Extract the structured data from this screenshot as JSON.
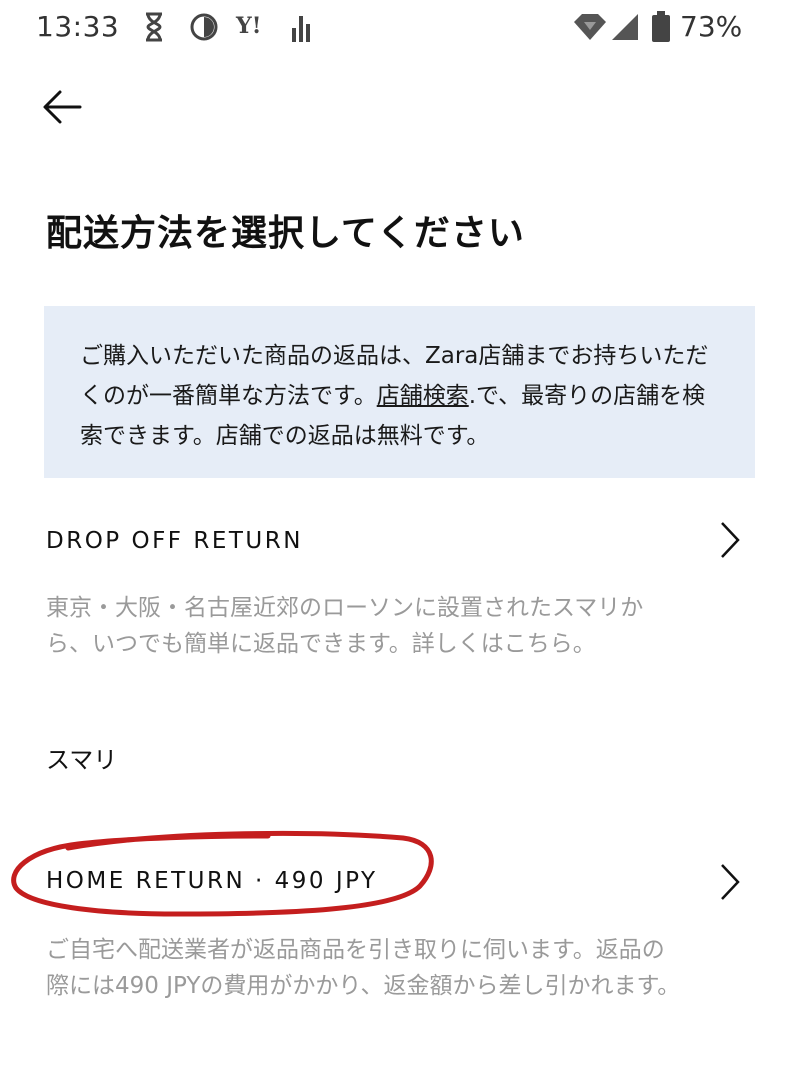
{
  "status_bar": {
    "time": "13:33",
    "yahoo_icon_text": "Y!",
    "battery_percent": "73%",
    "icons": [
      "hourglass-icon",
      "dnd-icon",
      "yahoo-icon",
      "signal-bars-icon",
      "wifi-icon",
      "cell-signal-icon",
      "battery-icon"
    ]
  },
  "header": {
    "title": "配送方法を選択してください"
  },
  "info": {
    "text_before_link": "ご購入いただいた商品の返品は、Zara店舗までお持ちいただくのが一番簡単な方法です。",
    "link_text": "店舗検索",
    "text_after_link": ".で、最寄りの店舗を検索できます。店舗での返品は無料です。"
  },
  "options": [
    {
      "title": "DROP OFF RETURN",
      "description": "東京・大阪・名古屋近郊のローソンに設置されたスマリから、いつでも簡単に返品できます。詳しくはこちら。",
      "extra_label": "スマリ"
    },
    {
      "title": "HOME RETURN · 490 JPY",
      "description": "ご自宅へ配送業者が返品商品を引き取りに伺います。返品の際には490 JPYの費用がかかり、返金額から差し引かれます。"
    }
  ],
  "colors": {
    "info_bg": "#e6edf7",
    "annotation": "#c41e1e",
    "muted_text": "#9a9a9a"
  }
}
